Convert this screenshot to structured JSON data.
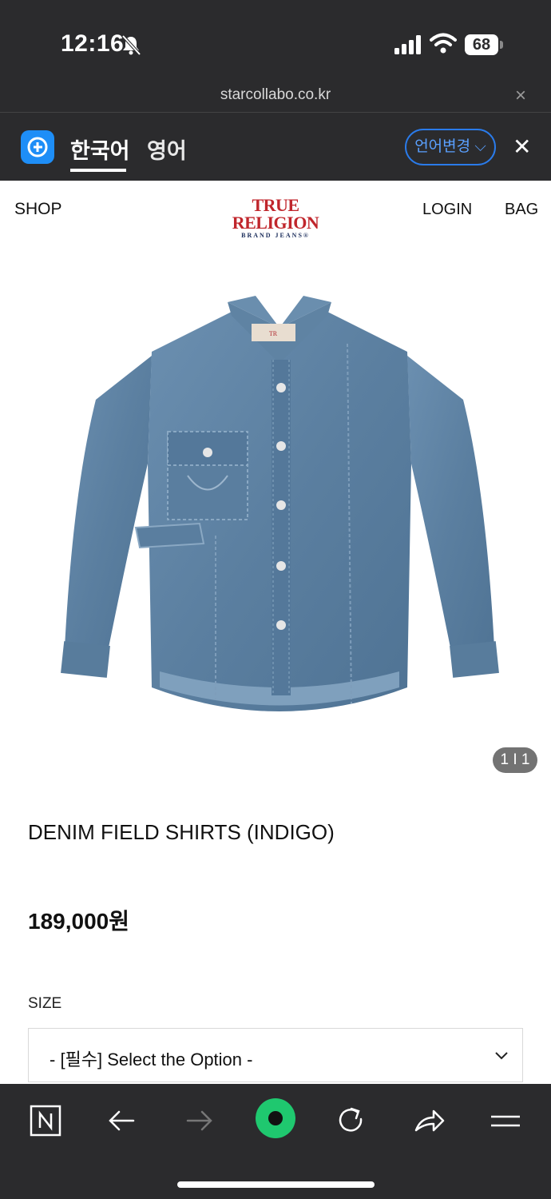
{
  "status_bar": {
    "time": "12:16",
    "battery": "68"
  },
  "browser": {
    "url": "starcollabo.co.kr",
    "url_close": "×"
  },
  "translate_bar": {
    "tab_korean": "한국어",
    "tab_english": "영어",
    "change_language": "언어변경 ⌵",
    "close": "✕"
  },
  "site_header": {
    "shop": "SHOP",
    "brand_main": "TRUE RELIGION",
    "brand_sub": "BRAND JEANS®",
    "login": "LOGIN",
    "bag": "BAG"
  },
  "gallery": {
    "counter": "1 I 1"
  },
  "product": {
    "title": "DENIM FIELD SHIRTS (INDIGO)",
    "price": "189,000원",
    "size_label": "SIZE",
    "size_placeholder": "- [필수] Select the Option -"
  },
  "colors": {
    "chrome_dark": "#2b2b2d",
    "accent_blue": "#1e8ef7",
    "brand_red": "#c0262c",
    "denim": "#5b7fa0",
    "record_green": "#1fc86f"
  },
  "icons": [
    "bell-slash-icon",
    "signal-icon",
    "wifi-icon",
    "battery-icon",
    "translate-logo-icon",
    "naver-n-icon",
    "back-arrow-icon",
    "forward-arrow-icon",
    "green-circle-icon",
    "reload-icon",
    "share-icon",
    "menu-icon",
    "chevron-down-icon"
  ]
}
